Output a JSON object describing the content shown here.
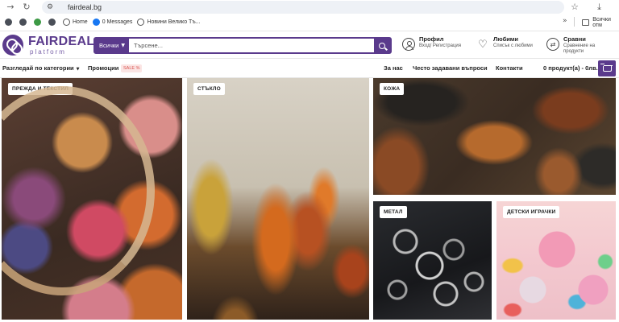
{
  "browser": {
    "url": "fairdeal.bg",
    "bookmarks": [
      {
        "label": "",
        "icon": "dark-circle-icon"
      },
      {
        "label": "",
        "icon": "dark-circle-icon"
      },
      {
        "label": "",
        "icon": "green-house-icon"
      },
      {
        "label": "",
        "icon": "dark-circle-icon"
      },
      {
        "label": "Home",
        "icon": "globe-icon"
      },
      {
        "label": "0 Messages",
        "icon": "facebook-icon"
      },
      {
        "label": "Новини Велико Тъ...",
        "icon": "globe-icon"
      }
    ],
    "more_bookmarks": "»",
    "all_bookmarks": "Всички отм"
  },
  "header": {
    "logo_brand": "FAIRDEAL",
    "logo_sub": "platform",
    "search": {
      "category": "Всички",
      "placeholder": "Търсене..."
    },
    "profile": {
      "title": "Профил",
      "sub": "Вход/ Регистрация"
    },
    "favorites": {
      "title": "Любими",
      "sub": "Списък с любими"
    },
    "compare": {
      "title": "Сравни",
      "sub": "Сравнение на продукти"
    }
  },
  "nav": {
    "categories": "Разгледай по категории",
    "promotions": "Промоции",
    "sale_badge": "SALE %",
    "about": "За нас",
    "faq": "Често задавани въпроси",
    "contacts": "Контакти",
    "cart_summary": "0 продукт(а) - 0лв."
  },
  "tiles": [
    {
      "label": "ПРЕЖДА И ТЕКСТИЛ"
    },
    {
      "label": "СТЪКЛО"
    },
    {
      "label": "КОЖА"
    },
    {
      "label": "МЕТАЛ"
    },
    {
      "label": "ДЕТСКИ ИГРАЧКИ"
    }
  ],
  "colors": {
    "brand": "#5a3a8c",
    "sale": "#d9534f"
  }
}
